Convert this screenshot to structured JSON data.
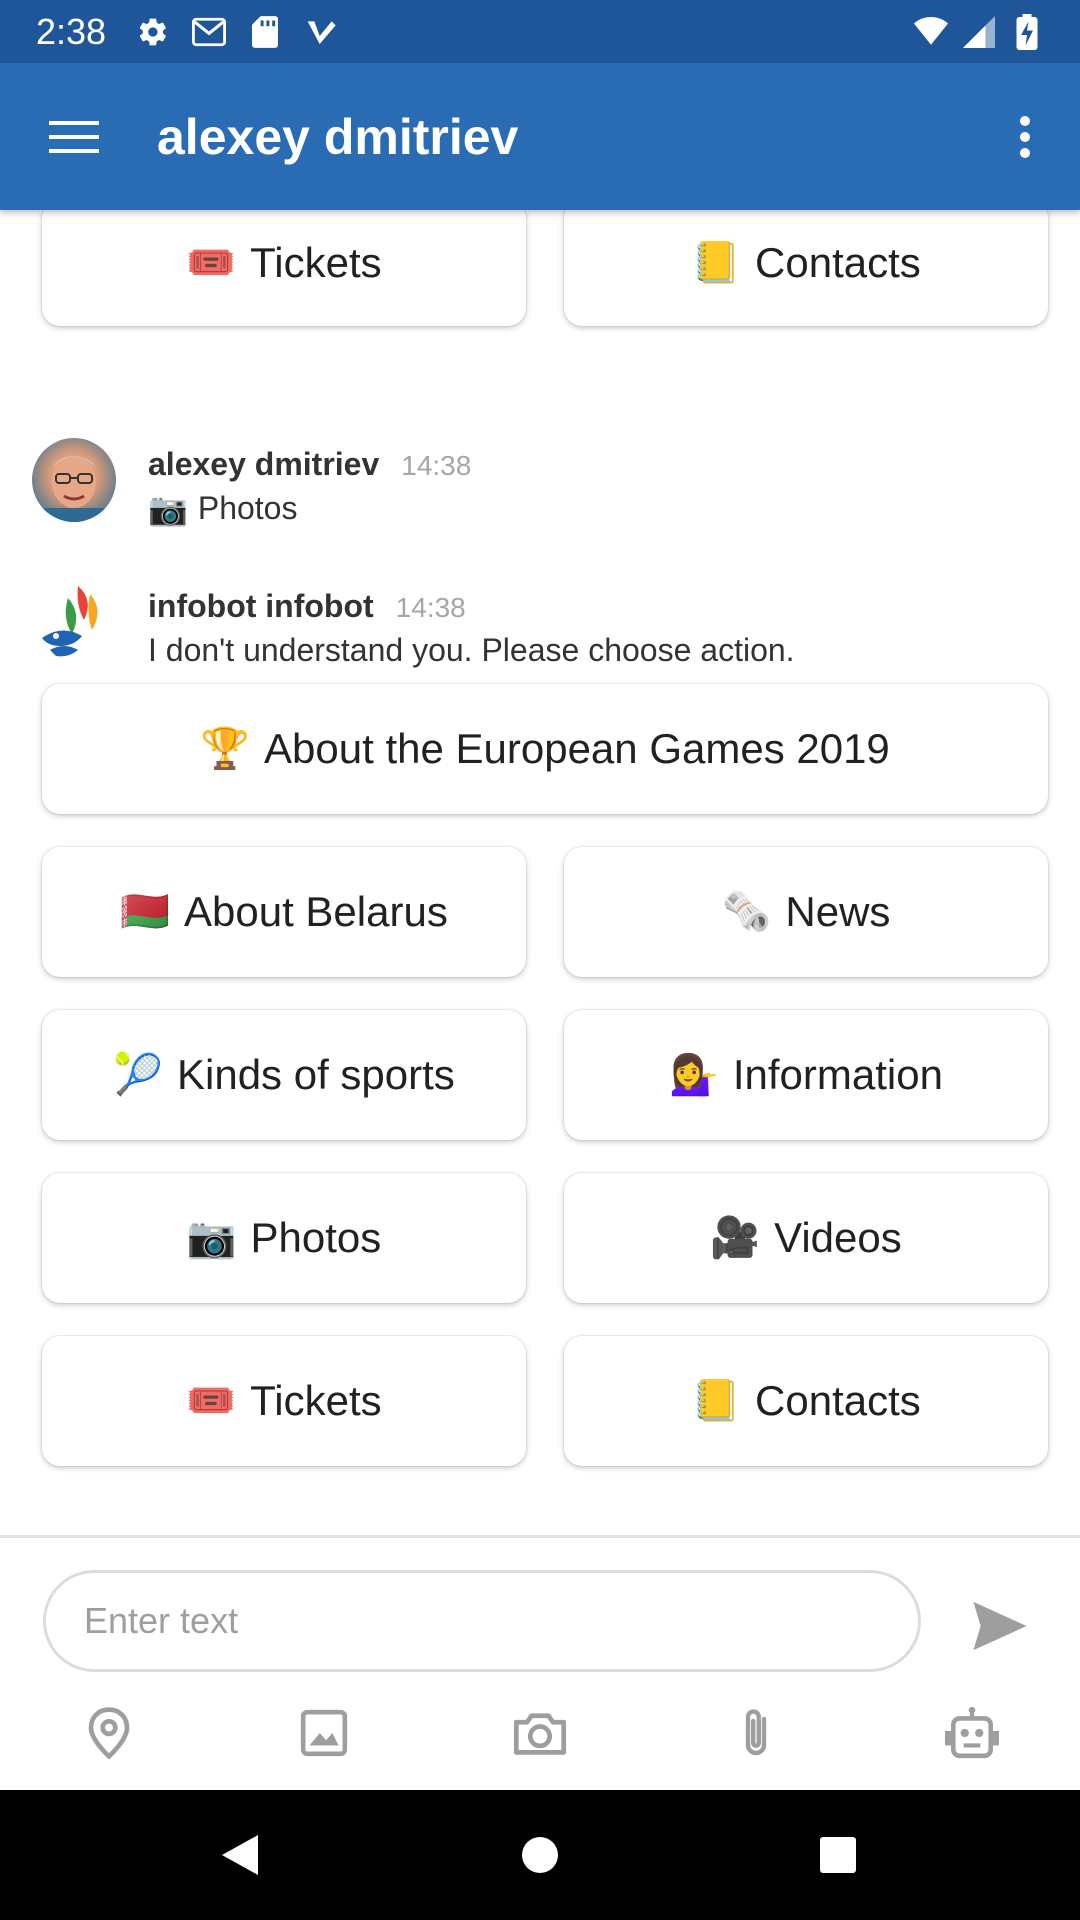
{
  "status_bar": {
    "time": "2:38",
    "icons_left": [
      "settings-icon",
      "gmail-icon",
      "sd-card-icon",
      "check-icon"
    ],
    "icons_right": [
      "wifi-icon",
      "signal-icon",
      "battery-charging-icon"
    ]
  },
  "app_bar": {
    "title": "alexey dmitriev",
    "color": "#2a6cb3"
  },
  "top_keyboard": [
    {
      "emoji": "🎟️",
      "label": "Tickets"
    },
    {
      "emoji": "📒",
      "label": "Contacts"
    }
  ],
  "messages": [
    {
      "author": "alexey dmitriev",
      "time": "14:38",
      "emoji": "📷",
      "text": "Photos"
    },
    {
      "author": "infobot infobot",
      "time": "14:38",
      "text": "I don't understand you. Please choose action."
    }
  ],
  "bot_keyboard": {
    "wide": {
      "emoji": "🏆",
      "label": "About the European Games 2019"
    },
    "rows": [
      [
        {
          "emoji": "🇧🇾",
          "label": "About Belarus"
        },
        {
          "emoji": "🗞️",
          "label": "News"
        }
      ],
      [
        {
          "emoji": "🎾",
          "label": "Kinds of sports"
        },
        {
          "emoji": "💁‍♀️",
          "label": "Information"
        }
      ],
      [
        {
          "emoji": "📷",
          "label": "Photos"
        },
        {
          "emoji": "🎥",
          "label": "Videos"
        }
      ],
      [
        {
          "emoji": "🎟️",
          "label": "Tickets"
        },
        {
          "emoji": "📒",
          "label": "Contacts"
        }
      ]
    ]
  },
  "composer": {
    "placeholder": "Enter text",
    "tools": [
      "location-icon",
      "gallery-icon",
      "camera-icon",
      "attach-icon",
      "bot-icon"
    ]
  },
  "nav_bar": [
    "back-icon",
    "home-icon",
    "recents-icon"
  ]
}
